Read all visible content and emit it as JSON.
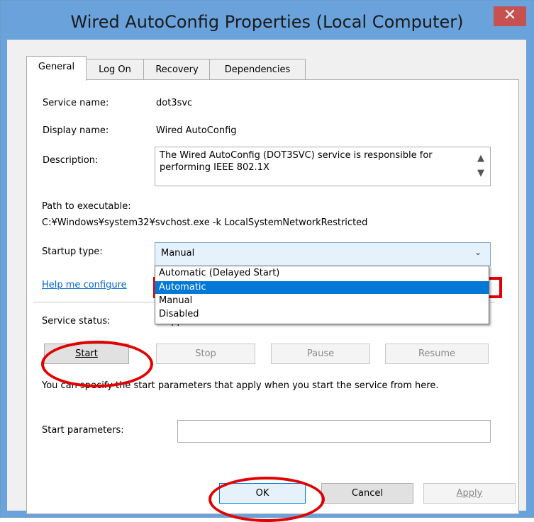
{
  "window": {
    "title": "Wired AutoConfig Properties (Local Computer)",
    "close_glyph": "✕"
  },
  "tabs": [
    {
      "label": "General",
      "active": true
    },
    {
      "label": "Log On",
      "active": false
    },
    {
      "label": "Recovery",
      "active": false
    },
    {
      "label": "Dependencies",
      "active": false
    }
  ],
  "general": {
    "service_name_label": "Service name:",
    "service_name_value": "dot3svc",
    "display_name_label": "Display name:",
    "display_name_value": "Wired AutoConfig",
    "description_label": "Description:",
    "description_value": "The Wired AutoConfig (DOT3SVC) service is responsible for performing IEEE 802.1X",
    "path_label": "Path to executable:",
    "path_value": "C:¥Windows¥system32¥svchost.exe -k LocalSystemNetworkRestricted",
    "startup_type_label": "Startup type:",
    "startup_type_value": "Manual",
    "startup_type_options": [
      "Automatic (Delayed Start)",
      "Automatic",
      "Manual",
      "Disabled"
    ],
    "startup_type_highlighted": "Automatic",
    "help_link": "Help me configure",
    "service_status_label": "Service status:",
    "service_status_value": "Stopped",
    "buttons": {
      "start": "Start",
      "stop": "Stop",
      "pause": "Pause",
      "resume": "Resume"
    },
    "start_params_note": "You can specify the start parameters that apply when you start the service from here.",
    "start_params_label": "Start parameters:",
    "start_params_value": ""
  },
  "footer": {
    "ok": "OK",
    "cancel": "Cancel",
    "apply": "Apply"
  },
  "colors": {
    "title_bar": "#6aa2dc",
    "close_button": "#c75050",
    "selection": "#0078d7",
    "annotation": "#e10000"
  }
}
